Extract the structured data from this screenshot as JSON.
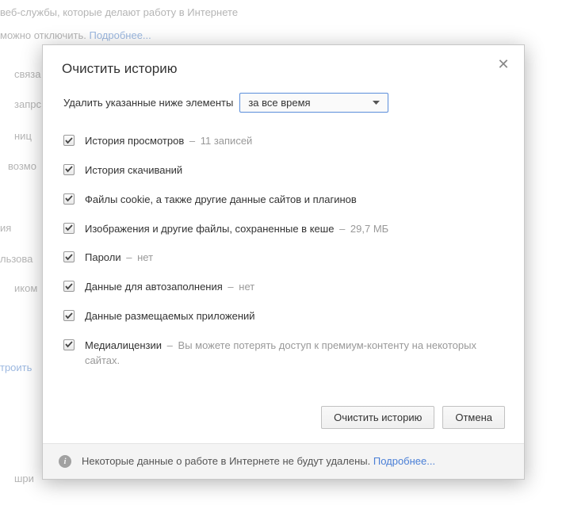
{
  "background": {
    "line1": "веб-службы, которые делают работу в Интернете",
    "line2_pre": "можно отключить. ",
    "line2_link": "Подробнее...",
    "frag1": "связа",
    "frag2": "запрс",
    "frag3": "ниц ",
    "frag4": "возмо",
    "frag5": "ия",
    "frag6": "льзова",
    "frag7": "иком",
    "frag8": "троить",
    "frag9": "шри"
  },
  "dialog": {
    "title": "Очистить историю",
    "delete_label": "Удалить указанные ниже элементы",
    "select_value": "за все время",
    "items": [
      {
        "label": "История просмотров",
        "meta": "11 записей",
        "dash": "–"
      },
      {
        "label": "История скачиваний",
        "meta": "",
        "dash": ""
      },
      {
        "label": "Файлы cookie, а также другие данные сайтов и плагинов",
        "meta": "",
        "dash": ""
      },
      {
        "label": "Изображения и другие файлы, сохраненные в кеше",
        "meta": "29,7 МБ",
        "dash": "–"
      },
      {
        "label": "Пароли",
        "meta": "нет",
        "dash": "–"
      },
      {
        "label": "Данные для автозаполнения",
        "meta": "нет",
        "dash": "–"
      },
      {
        "label": "Данные размещаемых приложений",
        "meta": "",
        "dash": ""
      },
      {
        "label": "Медиалицензии",
        "meta": "Вы можете потерять доступ к премиум-контенту на некоторых сайтах.",
        "dash": "–"
      }
    ],
    "clear_btn": "Очистить историю",
    "cancel_btn": "Отмена",
    "info_text": "Некоторые данные о работе в Интернете не будут удалены. ",
    "info_link": "Подробнее..."
  }
}
